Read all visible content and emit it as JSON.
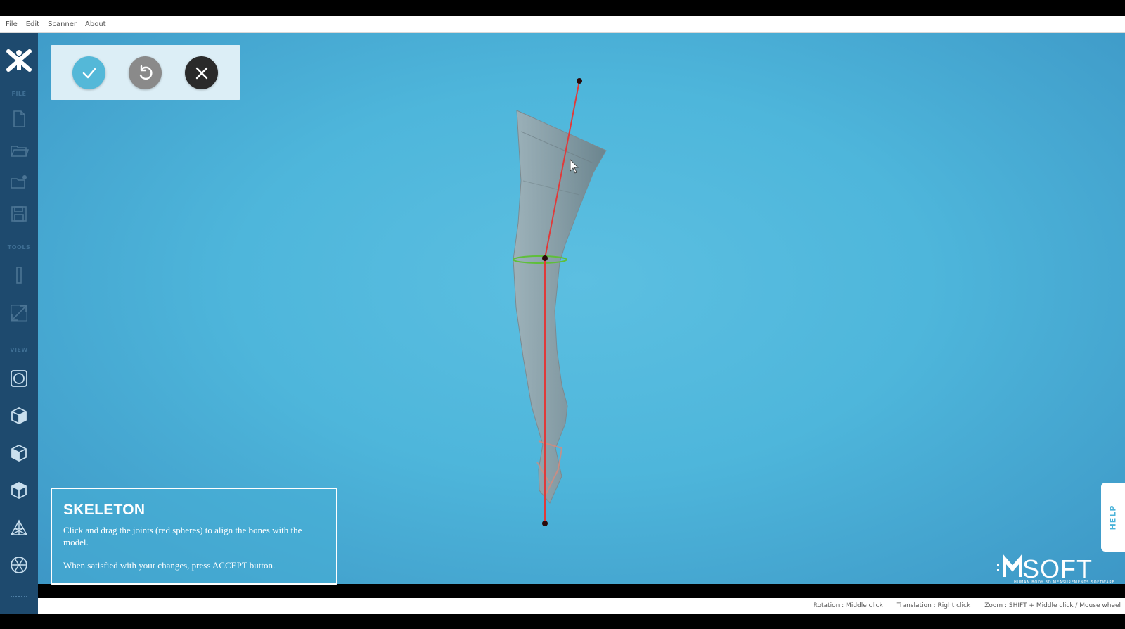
{
  "menu": {
    "items": [
      "File",
      "Edit",
      "Scanner",
      "About"
    ]
  },
  "sidebar": {
    "sections": {
      "file": "FILE",
      "tools": "TOOLS",
      "view": "VIEW"
    },
    "file_icons": [
      "new-file-icon",
      "open-folder-icon",
      "open-scan-icon",
      "save-icon"
    ],
    "tool_icons": [
      "ruler-icon",
      "measure-diagonal-icon"
    ],
    "view_icons": [
      "view-front-icon",
      "cube-solid-icon",
      "cube-shaded-icon",
      "cube-wire-icon",
      "mesh-icon",
      "skeleton-view-icon"
    ]
  },
  "actions": {
    "accept_icon": "check-icon",
    "reset_icon": "rotate-ccw-icon",
    "cancel_icon": "close-icon"
  },
  "info": {
    "title": "SKELETON",
    "line1": "Click and drag the joints (red spheres) to align the bones with the model.",
    "line2": "When satisfied with your changes, press ACCEPT button."
  },
  "help": {
    "label": "HELP"
  },
  "brand": {
    "name": "SOFT",
    "tagline": "HUMAN BODY 3D MEASUREMENTS SOFTWARE"
  },
  "status": {
    "rotation": "Rotation : Middle click",
    "translation": "Translation : Right click",
    "zoom": "Zoom : SHIFT + Middle click / Mouse wheel"
  },
  "colors": {
    "sidebar": "#1e4a6e",
    "viewport": "#4eb6db",
    "accept": "#54b8d8",
    "bone": "#e03a3a",
    "knee_ring": "#5fbf3a"
  }
}
